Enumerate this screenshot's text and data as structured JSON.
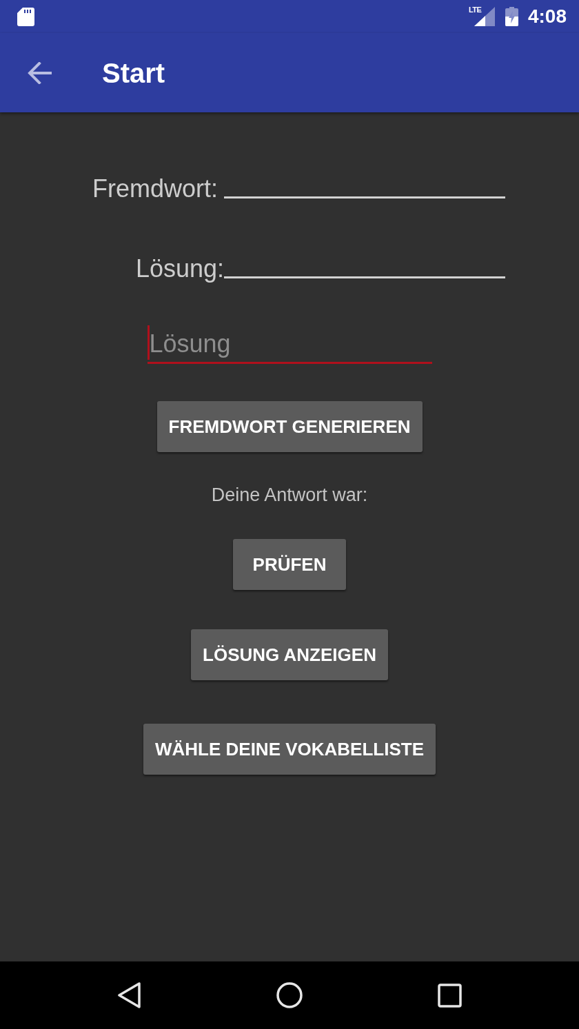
{
  "status_bar": {
    "network_label": "LTE",
    "time": "4:08"
  },
  "app_bar": {
    "title": "Start"
  },
  "word_rows": [
    {
      "label": "Fremdwort:"
    },
    {
      "label": "Lösung:"
    }
  ],
  "answer_input": {
    "placeholder": "Lösung",
    "focused": true
  },
  "content": [
    {
      "kind": "button",
      "label": "FREMDWORT GENERIEREN"
    },
    {
      "kind": "text",
      "text": "Deine Antwort war:"
    },
    {
      "kind": "button",
      "label": "PRÜFEN"
    },
    {
      "kind": "button",
      "label": "LÖSUNG ANZEIGEN"
    },
    {
      "kind": "button",
      "label": "WÄHLE DEINE VOKABELLISTE"
    }
  ]
}
